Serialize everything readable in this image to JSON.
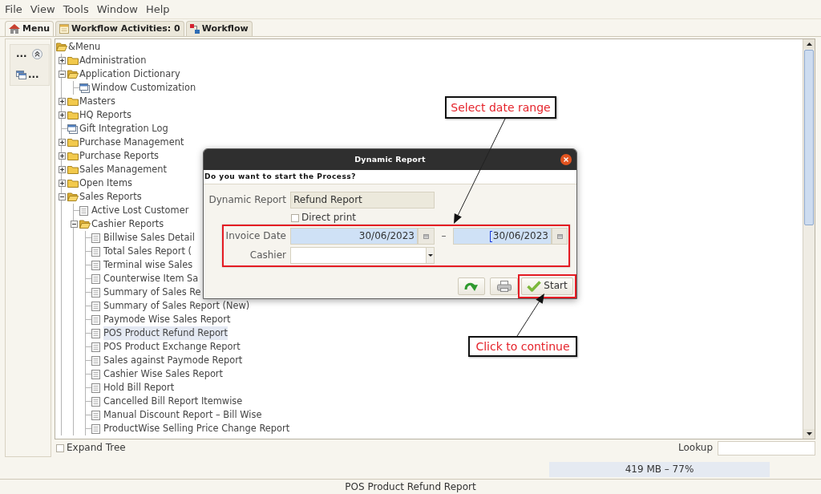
{
  "menu_bar": {
    "items": [
      "File",
      "View",
      "Tools",
      "Window",
      "Help"
    ]
  },
  "tabs": [
    {
      "label": "Menu",
      "selected": true
    },
    {
      "label": "Workflow Activities: 0",
      "selected": false
    },
    {
      "label": "Workflow",
      "selected": false
    }
  ],
  "side_panel": {
    "title": "...",
    "items": [
      {
        "label": "..."
      }
    ]
  },
  "tree": [
    {
      "label": "&Menu",
      "kind": "folder",
      "expanded": true,
      "selected": false,
      "children": [
        {
          "label": "Administration",
          "kind": "folder",
          "expanded": false,
          "selected": false
        },
        {
          "label": "Application Dictionary",
          "kind": "folder",
          "expanded": true,
          "selected": false,
          "children": [
            {
              "label": "Window Customization",
              "kind": "window",
              "selected": false
            }
          ]
        },
        {
          "label": "Masters",
          "kind": "folder",
          "expanded": false,
          "selected": false
        },
        {
          "label": "HQ Reports",
          "kind": "folder",
          "expanded": false,
          "selected": false
        },
        {
          "label": "Gift Integration Log",
          "kind": "window",
          "selected": false
        },
        {
          "label": "Purchase Management",
          "kind": "folder",
          "expanded": false,
          "selected": false
        },
        {
          "label": "Purchase Reports",
          "kind": "folder",
          "expanded": false,
          "selected": false
        },
        {
          "label": "Sales Management",
          "kind": "folder",
          "expanded": false,
          "selected": false
        },
        {
          "label": "Open Items",
          "kind": "folder",
          "expanded": false,
          "selected": false
        },
        {
          "label": "Sales Reports",
          "kind": "folder",
          "expanded": true,
          "selected": false,
          "children": [
            {
              "label": "Active Lost Customer",
              "kind": "report",
              "selected": false
            },
            {
              "label": "Cashier Reports",
              "kind": "folder",
              "expanded": true,
              "selected": false,
              "children": [
                {
                  "label": "Billwise Sales Detail",
                  "kind": "report",
                  "selected": false
                },
                {
                  "label": "Total Sales Report (",
                  "kind": "report",
                  "selected": false
                },
                {
                  "label": "Terminal wise Sales",
                  "kind": "report",
                  "selected": false
                },
                {
                  "label": "Counterwise Item Sa",
                  "kind": "report",
                  "selected": false
                },
                {
                  "label": "Summary of Sales Re",
                  "kind": "report",
                  "selected": false
                },
                {
                  "label": "Summary of Sales Report (New)",
                  "kind": "report",
                  "selected": false
                },
                {
                  "label": "Paymode Wise Sales Report",
                  "kind": "report",
                  "selected": false
                },
                {
                  "label": "POS Product Refund Report",
                  "kind": "report",
                  "selected": true
                },
                {
                  "label": "POS Product Exchange Report",
                  "kind": "report",
                  "selected": false
                },
                {
                  "label": "Sales against Paymode Report",
                  "kind": "report",
                  "selected": false
                },
                {
                  "label": "Cashier Wise Sales Report",
                  "kind": "report",
                  "selected": false
                },
                {
                  "label": "Hold Bill Report",
                  "kind": "report",
                  "selected": false
                },
                {
                  "label": "Cancelled Bill Report Itemwise",
                  "kind": "report",
                  "selected": false
                },
                {
                  "label": "Manual Discount Report – Bill Wise",
                  "kind": "report",
                  "selected": false
                },
                {
                  "label": "ProductWise Selling Price Change Report",
                  "kind": "report",
                  "selected": false
                }
              ]
            }
          ]
        }
      ]
    }
  ],
  "expand_tree": {
    "label": "Expand Tree",
    "checked": false
  },
  "lookup": {
    "label": "Lookup"
  },
  "memory_usage": "419 MB – 77%",
  "status_bar": {
    "text": "POS Product Refund Report"
  },
  "dialog": {
    "title": "Dynamic Report",
    "prompt": "Do you want to start the Process?",
    "fields": [
      {
        "kind": "text",
        "label": "Dynamic Report",
        "value": "Refund Report",
        "readonly": true,
        "highlighted": false
      },
      {
        "kind": "checkbox",
        "label": "Direct print",
        "checked": false,
        "highlighted": false
      },
      {
        "kind": "daterange",
        "label": "Invoice Date",
        "mandatory": true,
        "values": [
          {
            "text": "30/06/2023",
            "focused": false
          },
          {
            "text": "30/06/2023",
            "focused": true
          }
        ],
        "separator": "–",
        "highlighted": true
      },
      {
        "kind": "select",
        "label": "Cashier",
        "mandatory": false,
        "highlighted": true
      }
    ],
    "buttons": [
      {
        "kind": "redo",
        "highlighted": false
      },
      {
        "kind": "print",
        "highlighted": false
      },
      {
        "kind": "start",
        "label": "Start",
        "highlighted": true
      }
    ]
  },
  "annotations": [
    {
      "text": "Select date range"
    },
    {
      "text": "Click to continue"
    }
  ]
}
